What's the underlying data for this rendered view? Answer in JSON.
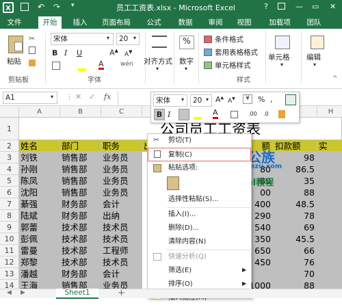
{
  "title": "员工工资表.xlsx - Microsoft Excel",
  "window_controls": {
    "help": "?",
    "minimize": "—",
    "restore": "▭",
    "close": "✕"
  },
  "colors": {
    "accent": "#217346",
    "header_fill": "#cbc62b",
    "selection_fill": "#bfbfbf",
    "menu_highlight_border": "#e46b6b"
  },
  "ribbon_tabs": [
    "文件",
    "开始",
    "插入",
    "页面布局",
    "公式",
    "数据",
    "审阅",
    "视图",
    "加载项",
    "团队"
  ],
  "active_tab": "开始",
  "ribbon": {
    "paste": "粘贴",
    "clipboard_group": "剪贴板",
    "font_name": "宋体",
    "font_size": "20",
    "font_group": "字体",
    "bold": "B",
    "italic": "I",
    "underline": "U",
    "align": "对齐方式",
    "number_btn": "数字",
    "percent": "%",
    "cond_format": "条件格式",
    "table_format": "套用表格格式",
    "cell_style": "单元格样式",
    "styles_group": "样式",
    "cells": "单元格",
    "editing": "编辑"
  },
  "formula_bar": {
    "name_box": "A1",
    "fx": "fx"
  },
  "mini_toolbar": {
    "font_name": "宋体",
    "font_size": "20",
    "bold": "B",
    "italic": "I"
  },
  "columns": [
    "A",
    "B",
    "C",
    "D",
    "E",
    "F",
    "G",
    "H"
  ],
  "rows": [
    "1",
    "2",
    "3",
    "4",
    "5",
    "6",
    "7",
    "8",
    "9",
    "10",
    "11",
    "12",
    "13",
    "14"
  ],
  "sheet_title": "公司员工工资表",
  "table": {
    "headers": [
      "姓名",
      "部门",
      "职务",
      "出",
      "额",
      "扣款额",
      "实"
    ],
    "rows": [
      [
        "刘铁",
        "销售部",
        "业务员",
        "",
        "98"
      ],
      [
        "孙刚",
        "销售部",
        "业务员",
        "80",
        "86.5"
      ],
      [
        "陈凤",
        "销售部",
        "业务员",
        "80",
        "35"
      ],
      [
        "沈阳",
        "销售部",
        "业务员",
        "00",
        "88"
      ],
      [
        "綦强",
        "财务部",
        "会计",
        "400",
        "48.5"
      ],
      [
        "陆斌",
        "财务部",
        "出纳",
        "290",
        "78"
      ],
      [
        "郭蕾",
        "技术部",
        "技术员",
        "540",
        "69"
      ],
      [
        "彭佩",
        "技术部",
        "技术员",
        "350",
        "45.5"
      ],
      [
        "雷曼",
        "技术部",
        "工程师",
        "650",
        "66"
      ],
      [
        "郑黎",
        "技术部",
        "技术员",
        "450",
        "76"
      ],
      [
        "潘越",
        "财务部",
        "会计",
        "",
        "70"
      ],
      [
        "王海",
        "销售部",
        "业务员",
        "1000",
        "88"
      ]
    ]
  },
  "context_menu": {
    "cut": "剪切(T)",
    "copy": "复制(C)",
    "paste_options": "粘贴选项:",
    "paste_special": "选择性粘贴(S)...",
    "insert": "插入(I)...",
    "delete": "删除(D)...",
    "clear": "清除内容(N)",
    "quick_analysis": "快速分析(Q)",
    "filter": "筛选(E)",
    "sort": "排序(O)",
    "insert_comment": "插入批注(M)"
  },
  "watermark": {
    "brand": "办公族",
    "sub": "Officezu.com",
    "text": "Excel教程"
  },
  "sheet_tab": "Sheet1",
  "add_sheet": "+"
}
